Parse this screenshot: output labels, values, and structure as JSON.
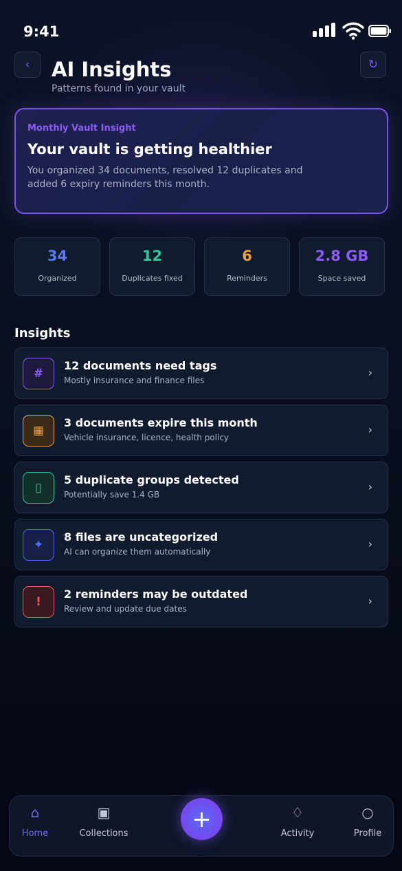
{
  "status_bar": {
    "time": "9:41"
  },
  "header": {
    "back_icon": "chevron-left",
    "refresh_icon": "refresh",
    "title": "AI Insights",
    "subtitle": "Patterns found in your vault"
  },
  "hero": {
    "eyebrow": "Monthly Vault Insight",
    "title": "Your vault is getting healthier",
    "body": "You organized 34 documents, resolved 12 duplicates and added 6 expiry reminders this month."
  },
  "stats": [
    {
      "value": "34",
      "label": "Organized",
      "color": "#5a78f0"
    },
    {
      "value": "12",
      "label": "Duplicates fixed",
      "color": "#2fc89a"
    },
    {
      "value": "6",
      "label": "Reminders",
      "color": "#f0a24a"
    },
    {
      "value": "2.8 GB",
      "label": "Space saved",
      "color": "#8b5cf6"
    }
  ],
  "insights_title": "Insights",
  "insights": [
    {
      "icon": "#",
      "icon_name": "hashtag-icon",
      "title": "12 documents need tags",
      "subtitle": "Mostly insurance and finance files",
      "color": "#8b5cf6",
      "bg": "#1e1a3e"
    },
    {
      "icon": "▦",
      "icon_name": "calendar-icon",
      "title": "3 documents expire this month",
      "subtitle": "Vehicle insurance, licence, health policy",
      "color": "#f0a24a",
      "bg": "#3a2a18"
    },
    {
      "icon": "▯",
      "icon_name": "copy-icon",
      "title": "5 duplicate groups detected",
      "subtitle": "Potentially save 1.4 GB",
      "color": "#2fc89a",
      "bg": "#12302a"
    },
    {
      "icon": "✦",
      "icon_name": "sparkle-icon",
      "title": "8 files are uncategorized",
      "subtitle": "AI can organize them automatically",
      "color": "#4f6ef5",
      "bg": "#162048"
    },
    {
      "icon": "!",
      "icon_name": "alert-icon",
      "title": "2 reminders may be outdated",
      "subtitle": "Review and update due dates",
      "color": "#f0575f",
      "bg": "#3a1820"
    }
  ],
  "nav": {
    "items": [
      {
        "icon": "⌂",
        "label": "Home"
      },
      {
        "icon": "▣",
        "label": "Collections"
      },
      {
        "icon": "♢",
        "label": "Activity"
      },
      {
        "icon": "○",
        "label": "Profile"
      }
    ],
    "fab_icon": "+"
  }
}
